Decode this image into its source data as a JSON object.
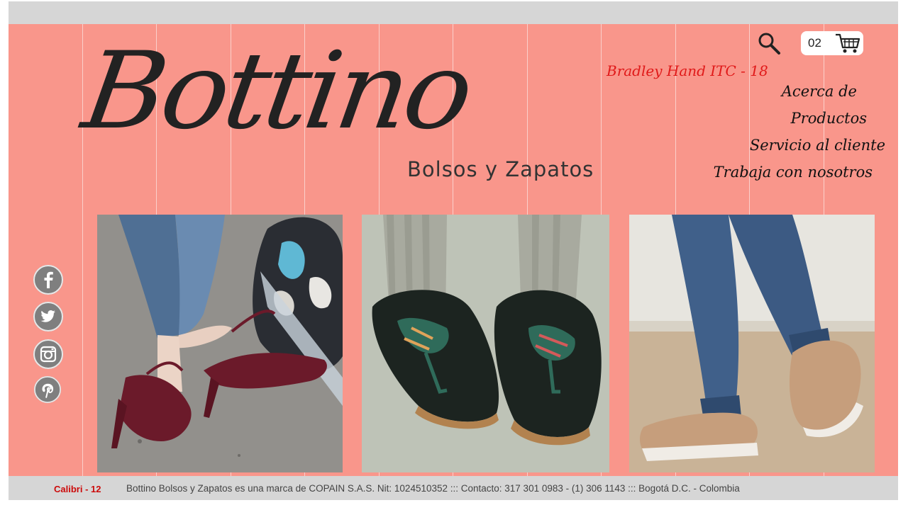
{
  "brand": {
    "logo_text": "Bottino",
    "tagline": "Bolsos y Zapatos"
  },
  "design_note": {
    "heading_font_label": "Bradley Hand ITC - 18",
    "footer_font_label": "Calibri - 12"
  },
  "header": {
    "search_icon": "search-icon",
    "cart": {
      "count": "02",
      "icon": "shopping-cart-icon"
    }
  },
  "nav": {
    "items": [
      {
        "label": "Acerca de"
      },
      {
        "label": "Productos"
      },
      {
        "label": "Servicio al cliente"
      },
      {
        "label": "Trabaja con nosotros"
      }
    ]
  },
  "social": {
    "items": [
      {
        "icon": "facebook-icon"
      },
      {
        "icon": "twitter-icon"
      },
      {
        "icon": "instagram-icon"
      },
      {
        "icon": "pinterest-icon"
      }
    ]
  },
  "gallery": {
    "items": [
      {
        "subject": "burgundy-heels-photo"
      },
      {
        "subject": "black-laced-shoes-photo"
      },
      {
        "subject": "tan-sneakers-photo"
      }
    ]
  },
  "footer": {
    "text": "Bottino Bolsos y Zapatos es una marca de COPAIN S.A.S. Nit: 1024510352  :::  Contacto: 317 301 0983 -  (1) 306 1143  :::  Bogotá D.C. - Colombia"
  },
  "colors": {
    "background": "#f9968b",
    "bar": "#d6d6d6",
    "accent_red": "#e01919",
    "icon_gray": "#7f7f7f"
  }
}
